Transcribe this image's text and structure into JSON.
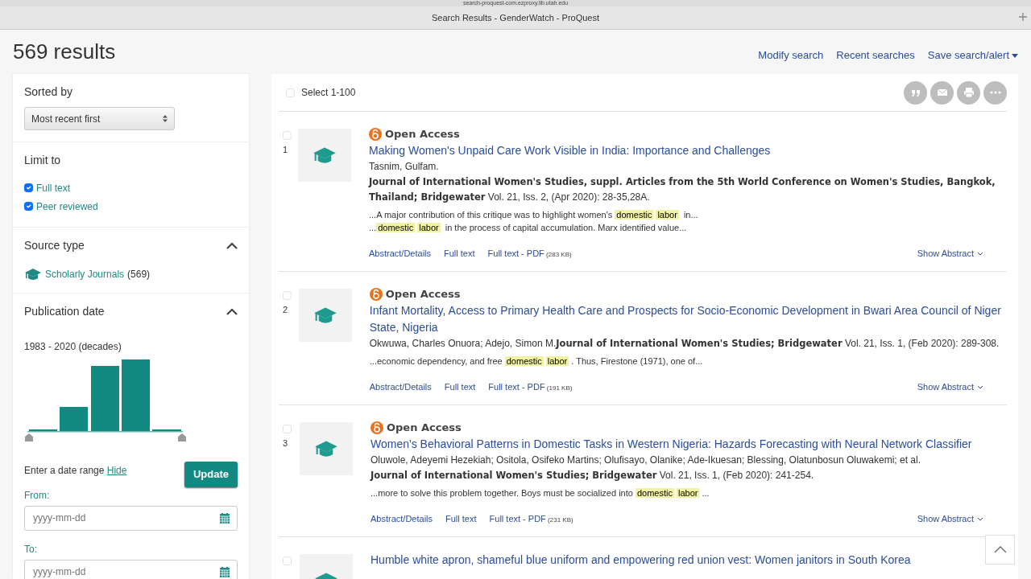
{
  "browser": {
    "url": "search-proquest-com.ezproxy.lib.utah.edu",
    "title": "Search Results - GenderWatch - ProQuest"
  },
  "header": {
    "result_count": "569 results",
    "actions": [
      {
        "label": "Modify search",
        "caret": false
      },
      {
        "label": "Recent searches",
        "caret": false
      },
      {
        "label": "Save search/alert",
        "caret": true
      }
    ]
  },
  "sidebar": {
    "sort": {
      "label": "Sorted by",
      "value": "Most recent first"
    },
    "limit": {
      "title": "Limit to",
      "options": [
        {
          "label": "Full text",
          "checked": true
        },
        {
          "label": "Peer reviewed",
          "checked": true
        }
      ]
    },
    "source_type": {
      "title": "Source type",
      "expanded": true,
      "items": [
        {
          "label": "Scholarly Journals",
          "count": "(569)"
        }
      ]
    },
    "publication_date": {
      "title": "Publication date",
      "expanded": true,
      "range_label": "1983 - 2020 (decades)",
      "date_range_label": "Enter a date range",
      "hide_link": "Hide",
      "update_button": "Update",
      "from": {
        "label": "From:",
        "placeholder": "yyyy-mm-dd"
      },
      "to": {
        "label": "To:",
        "placeholder": "yyyy-mm-dd"
      }
    }
  },
  "results": {
    "select_all": {
      "label": "Select 1-100",
      "checked": false
    },
    "records": [
      {
        "number": "1",
        "checked": false,
        "badge": "Open Access",
        "title": "Making Women's Unpaid Care Work Visible in India: Importance and Challenges",
        "lines": [
          "Tasnim, Gulfam.",
          "**Journal of International Women's Studies, suppl. Articles from the 5th World Conference on Women's Studies, Bangkok, Thailand; Bridgewater** Vol. 21, Iss. 2,  (Apr 2020): 28-35,28A."
        ],
        "snippets": [
          [
            {
              "text": "...A major contribution of this critique was to highlight women's ",
              "highlight": false
            },
            {
              "text": "domestic",
              "highlight": true
            },
            {
              "text": "labor",
              "highlight": true
            },
            {
              "text": " in...",
              "highlight": false
            }
          ],
          [
            {
              "text": "...",
              "highlight": false
            },
            {
              "text": "domestic",
              "highlight": true
            },
            {
              "text": "labor",
              "highlight": true
            },
            {
              "text": " in the process of capital accumulation. Marx identified value...",
              "highlight": false
            }
          ]
        ],
        "links": [
          {
            "label": "Abstract/Details"
          },
          {
            "label": "Full text"
          },
          {
            "label": "Full text - PDF",
            "size": "(283 KB)"
          }
        ],
        "show_abstract": "Show Abstract"
      },
      {
        "number": "2",
        "checked": false,
        "badge": "Open Access",
        "title": "Infant Mortality, Access to Primary Health Care and Prospects for Socio-Economic Development in Bwari Area Council of Niger State, Nigeria",
        "lines": [
          "Okwuwa, Charles Onuora; Adejo, Simon M.**Journal of International Women's Studies; Bridgewater** Vol. 21, Iss. 1,  (Feb 2020): 289-308."
        ],
        "snippets": [
          [
            {
              "text": "...economic dependency, and free ",
              "highlight": false
            },
            {
              "text": "domestic",
              "highlight": true
            },
            {
              "text": "labor",
              "highlight": true
            },
            {
              "text": ". Thus, Firestone (1971), one of...",
              "highlight": false
            }
          ]
        ],
        "links": [
          {
            "label": "Abstract/Details"
          },
          {
            "label": "Full text"
          },
          {
            "label": "Full text - PDF",
            "size": "(191 KB)"
          }
        ],
        "show_abstract": "Show Abstract"
      },
      {
        "number": "3",
        "checked": false,
        "badge": "Open Access",
        "title": "Women's Behavioral Patterns in Domestic Tasks in Western Nigeria: Hazards Forecasting with Neural Network Classifier",
        "lines": [
          "Oluwole, Adeyemi Hezekiah; Ositola, Osifeko Martins; Olufisayo, Olanike; Ade-Ikuesan; Blessing, Olatunbosun Oluwakemi; et al.",
          "**Journal of International Women's Studies; Bridgewater** Vol. 21, Iss. 1,  (Feb 2020): 241-254."
        ],
        "snippets": [
          [
            {
              "text": "...more to solve this problem together. Boys must be socialized into ",
              "highlight": false
            },
            {
              "text": "domestic",
              "highlight": true
            },
            {
              "text": "labor",
              "highlight": true
            },
            {
              "text": "...",
              "highlight": false
            }
          ]
        ],
        "links": [
          {
            "label": "Abstract/Details"
          },
          {
            "label": "Full text"
          },
          {
            "label": "Full text - PDF",
            "size": "(231 KB)"
          }
        ],
        "show_abstract": "Show Abstract"
      },
      {
        "checked": false,
        "title": "Humble white apron, shameful blue uniform and empowering red union vest: Women janitors in South Korea"
      }
    ]
  }
}
